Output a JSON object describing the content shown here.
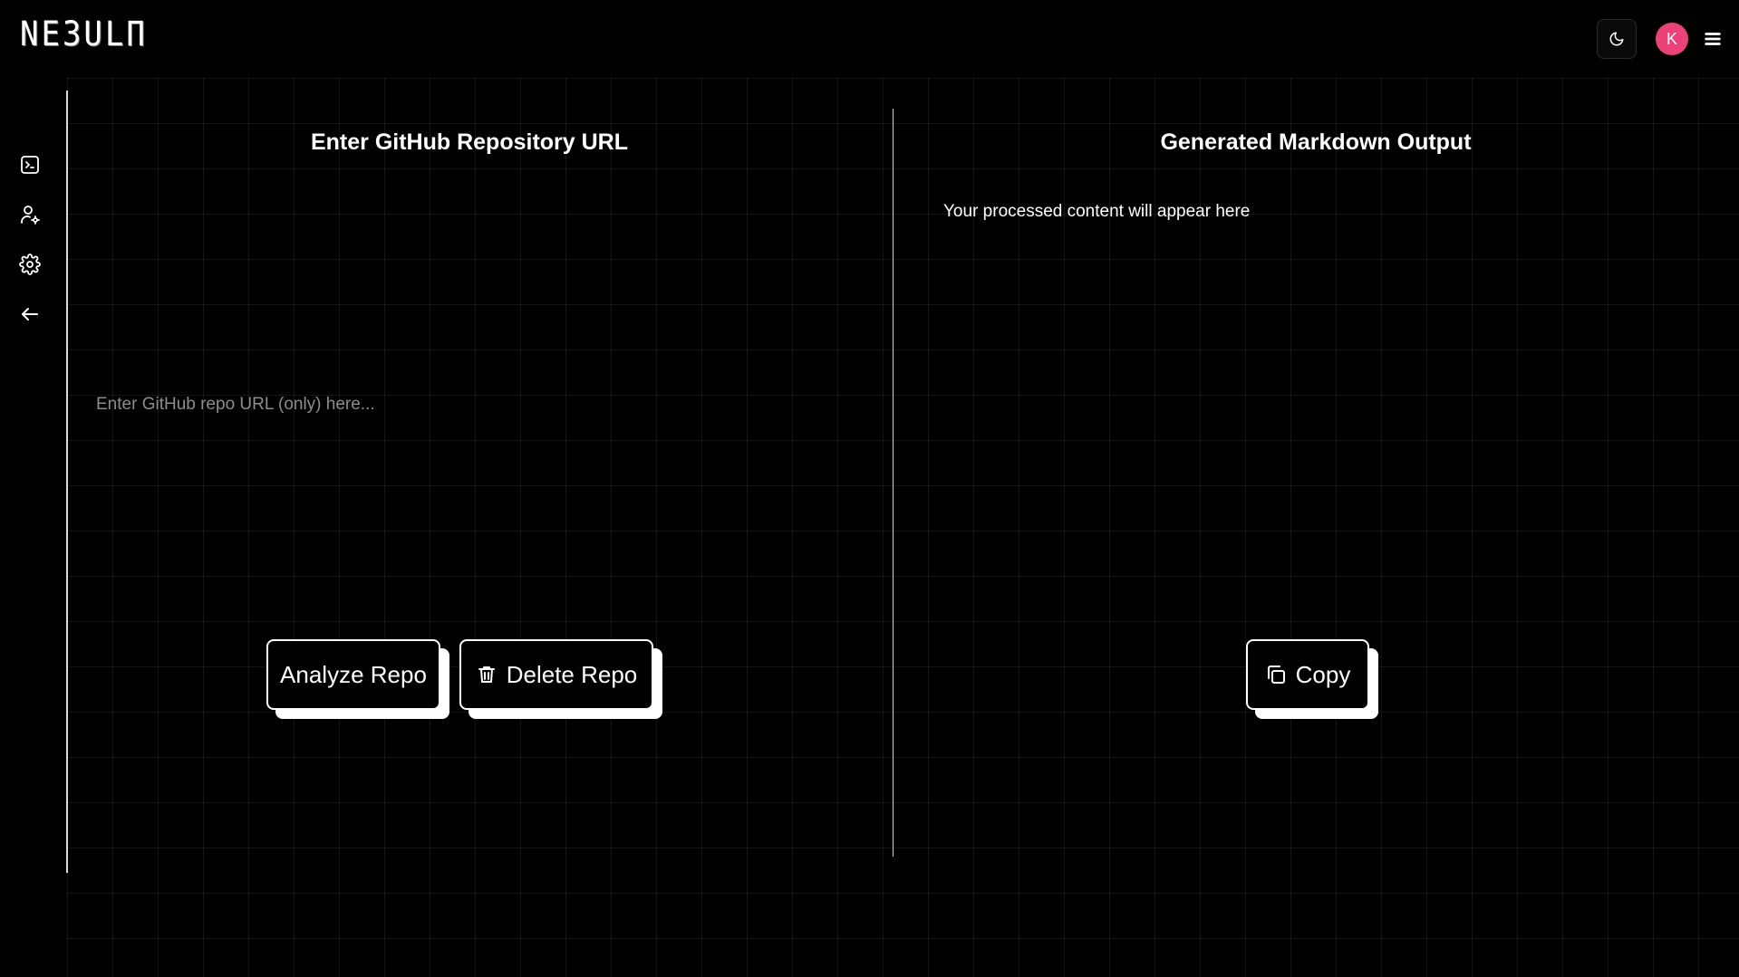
{
  "header": {
    "logo_text": "NE3ULΠ",
    "theme_toggle_icon": "moon-icon",
    "avatar_initial": "K",
    "avatar_color": "#ec4179",
    "menu_icon": "hamburger-menu-icon"
  },
  "sidebar": {
    "items": [
      {
        "icon": "terminal-icon"
      },
      {
        "icon": "user-settings-icon"
      },
      {
        "icon": "gear-icon"
      },
      {
        "icon": "arrow-left-icon"
      }
    ]
  },
  "input_panel": {
    "title": "Enter GitHub Repository URL",
    "url_placeholder": "Enter GitHub repo URL (only) here...",
    "url_value": "",
    "analyze_button": "Analyze Repo",
    "delete_button": "Delete Repo",
    "delete_icon": "trash-icon"
  },
  "output_panel": {
    "title": "Generated Markdown Output",
    "placeholder_text": "Your processed content will appear here",
    "copy_button": "Copy",
    "copy_icon": "copy-icon"
  },
  "colors": {
    "background": "#000000",
    "foreground": "#ffffff",
    "accent": "#ec4179"
  }
}
